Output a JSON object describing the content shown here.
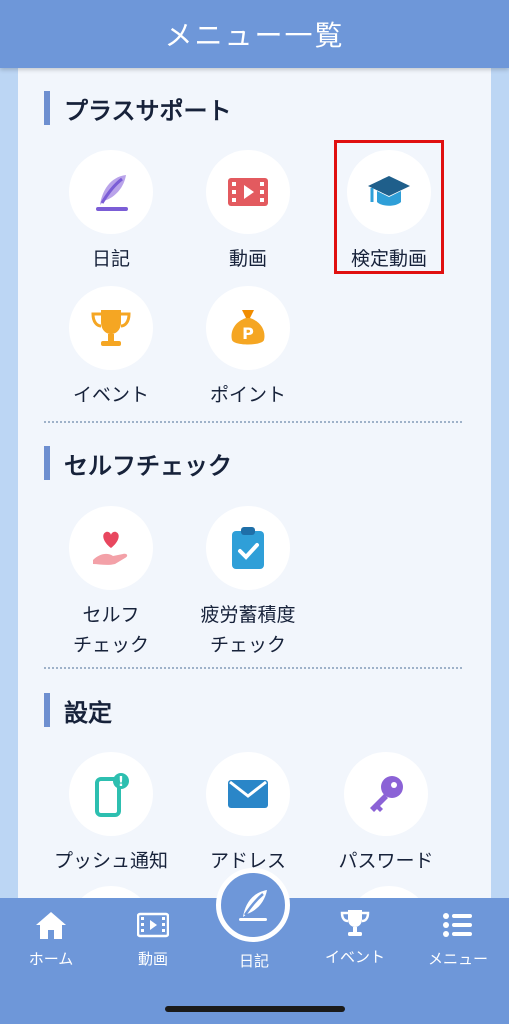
{
  "header": {
    "title": "メニュー一覧"
  },
  "sections": {
    "plus_support": {
      "title": "プラスサポート",
      "items": [
        {
          "label": "日記",
          "icon": "quill-pen-icon"
        },
        {
          "label": "動画",
          "icon": "film-icon"
        },
        {
          "label": "検定動画",
          "icon": "graduation-cap-icon"
        },
        {
          "label": "イベント",
          "icon": "trophy-icon"
        },
        {
          "label": "ポイント",
          "icon": "points-bag-icon"
        }
      ]
    },
    "self_check": {
      "title": "セルフチェック",
      "items": [
        {
          "label_line1": "セルフ",
          "label_line2": "チェック",
          "icon": "heart-hand-icon"
        },
        {
          "label_line1": "疲労蓄積度",
          "label_line2": "チェック",
          "icon": "clipboard-check-icon"
        }
      ]
    },
    "settings": {
      "title": "設定",
      "items": [
        {
          "label": "プッシュ通知",
          "icon": "phone-notification-icon"
        },
        {
          "label": "アドレス",
          "icon": "mail-icon"
        },
        {
          "label": "パスワード",
          "icon": "key-icon"
        }
      ]
    }
  },
  "tabbar": {
    "items": [
      {
        "label": "ホーム",
        "icon": "home-icon"
      },
      {
        "label": "動画",
        "icon": "film-icon"
      },
      {
        "label": "日記",
        "icon": "quill-pen-icon"
      },
      {
        "label": "イベント",
        "icon": "trophy-icon"
      },
      {
        "label": "メニュー",
        "icon": "menu-list-icon"
      }
    ]
  },
  "colors": {
    "header": "#6e97d9",
    "panel": "#f2f6fc",
    "page": "#bcd6f4",
    "highlight": "#e01010"
  }
}
